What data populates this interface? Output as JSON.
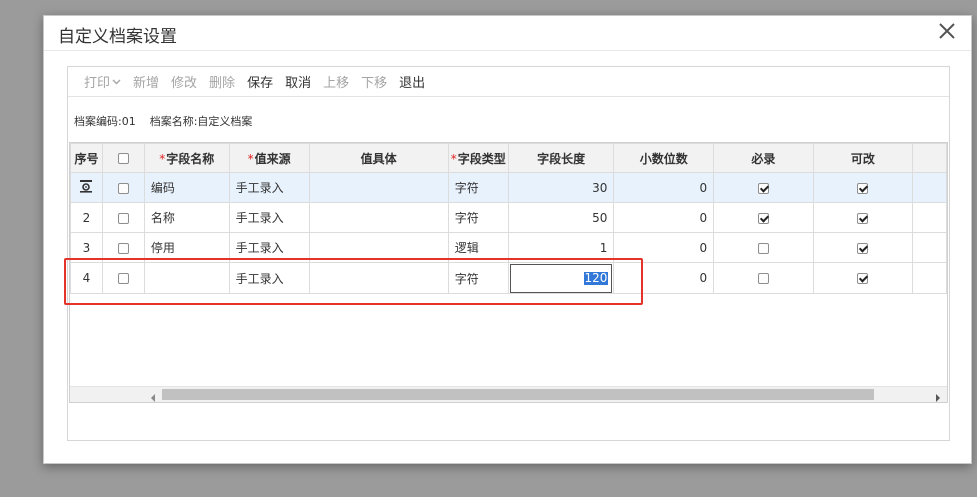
{
  "dialog": {
    "title": "自定义档案设置",
    "close_icon": "close-icon"
  },
  "toolbar": {
    "print": "打印",
    "add": "新增",
    "modify": "修改",
    "delete": "删除",
    "save": "保存",
    "cancel": "取消",
    "move_up": "上移",
    "move_down": "下移",
    "exit": "退出"
  },
  "info": {
    "code": "档案编码:01",
    "name": "档案名称:自定义档案"
  },
  "grid": {
    "headers": {
      "seq": "序号",
      "name": "字段名称",
      "source": "值来源",
      "entity": "值具体",
      "type": "字段类型",
      "length": "字段长度",
      "decimals": "小数位数",
      "required": "必录",
      "editable": "可改"
    },
    "required_mark": "*",
    "rows": [
      {
        "seq": "",
        "checked": false,
        "name": "编码",
        "source": "手工录入",
        "entity": "",
        "type": "字符",
        "length": "30",
        "decimals": "0",
        "required": true,
        "editable": true,
        "selected": true
      },
      {
        "seq": "2",
        "checked": false,
        "name": "名称",
        "source": "手工录入",
        "entity": "",
        "type": "字符",
        "length": "50",
        "decimals": "0",
        "required": true,
        "editable": true,
        "selected": false
      },
      {
        "seq": "3",
        "checked": false,
        "name": "停用",
        "source": "手工录入",
        "entity": "",
        "type": "逻辑",
        "length": "1",
        "decimals": "0",
        "required": false,
        "editable": true,
        "selected": false
      },
      {
        "seq": "4",
        "checked": false,
        "name": "",
        "source": "手工录入",
        "entity": "",
        "type": "字符",
        "length": "120",
        "decimals": "0",
        "required": false,
        "editable": true,
        "selected": false,
        "editing": true
      }
    ]
  },
  "colors": {
    "highlight": "#e5332a",
    "selected_row": "#e8f2fc",
    "selection": "#3178d8"
  }
}
